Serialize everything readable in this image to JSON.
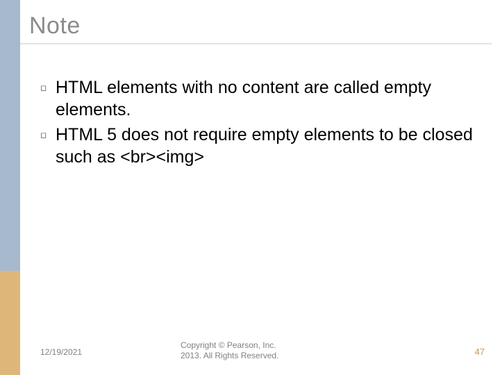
{
  "title": "Note",
  "bullets": [
    "HTML elements with no content are called empty elements.",
    "HTML 5 does not require empty elements to be closed such as <br><img>"
  ],
  "footer": {
    "date": "12/19/2021",
    "copyright_line1": "Copyright © Pearson, Inc.",
    "copyright_line2": "2013. All Rights Reserved.",
    "page": "47"
  },
  "colors": {
    "sidebar_top": "#a7b9cc",
    "sidebar_bottom": "#dfb67a",
    "title": "#8b8b8b",
    "page_number": "#c59b5f"
  }
}
